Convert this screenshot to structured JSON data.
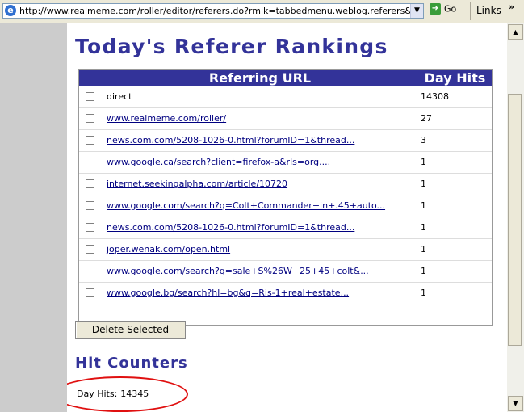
{
  "browser": {
    "address": "http://www.realmeme.com/roller/editor/referers.do?rmik=tabbedmenu.weblog.referers&username=r",
    "go_label": "Go",
    "links_label": "Links",
    "links_chevron": "»",
    "dropdown_glyph": "▼"
  },
  "page": {
    "title": "Today's Referer Rankings",
    "table": {
      "headers": {
        "url": "Referring URL",
        "hits": "Day Hits"
      },
      "rows": [
        {
          "url": "direct",
          "hits": "14308",
          "is_link": false
        },
        {
          "url": "www.realmeme.com/roller/",
          "hits": "27",
          "is_link": true
        },
        {
          "url": "news.com.com/5208-1026-0.html?forumID=1&thread...",
          "hits": "3",
          "is_link": true
        },
        {
          "url": "www.google.ca/search?client=firefox-a&rls=org....",
          "hits": "1",
          "is_link": true
        },
        {
          "url": "internet.seekingalpha.com/article/10720",
          "hits": "1",
          "is_link": true
        },
        {
          "url": "www.google.com/search?q=Colt+Commander+in+.45+auto...",
          "hits": "1",
          "is_link": true
        },
        {
          "url": "news.com.com/5208-1026-0.html?forumID=1&thread...",
          "hits": "1",
          "is_link": true
        },
        {
          "url": "joper.wenak.com/open.html",
          "hits": "1",
          "is_link": true
        },
        {
          "url": "www.google.com/search?q=sale+S%26W+25+45+colt&...",
          "hits": "1",
          "is_link": true
        },
        {
          "url": "www.google.bg/search?hl=bg&q=Ris-1+real+estate...",
          "hits": "1",
          "is_link": true
        }
      ]
    },
    "delete_button": "Delete Selected",
    "hit_counters": {
      "title": "Hit Counters",
      "day_hits_label": "Day Hits:",
      "day_hits_value": "14345"
    }
  },
  "colors": {
    "heading": "#333399",
    "table_header_bg": "#333399",
    "link": "#000080",
    "annotation": "#e01010",
    "gutter": "#cccccc"
  }
}
